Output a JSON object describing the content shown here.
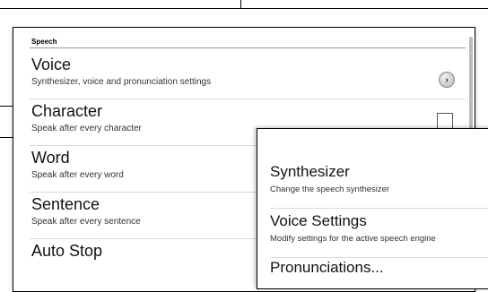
{
  "main": {
    "section_header": "Speech",
    "items": [
      {
        "title": "Voice",
        "summary": "Synthesizer, voice and pronunciation settings"
      },
      {
        "title": "Character",
        "summary": "Speak after every character"
      },
      {
        "title": "Word",
        "summary": "Speak after every word"
      },
      {
        "title": "Sentence",
        "summary": "Speak after every sentence"
      },
      {
        "title": "Auto Stop",
        "summary": ""
      }
    ],
    "character_checked": false
  },
  "front": {
    "items": [
      {
        "title": "Synthesizer",
        "summary": "Change the speech synthesizer"
      },
      {
        "title": "Voice Settings",
        "summary": "Modify settings for the active speech engine"
      },
      {
        "title": "Pronunciations...",
        "summary": ""
      }
    ]
  },
  "icons": {
    "voice_arrow": "chevron-right-circle-icon",
    "character_checkbox": "checkbox-unchecked"
  }
}
